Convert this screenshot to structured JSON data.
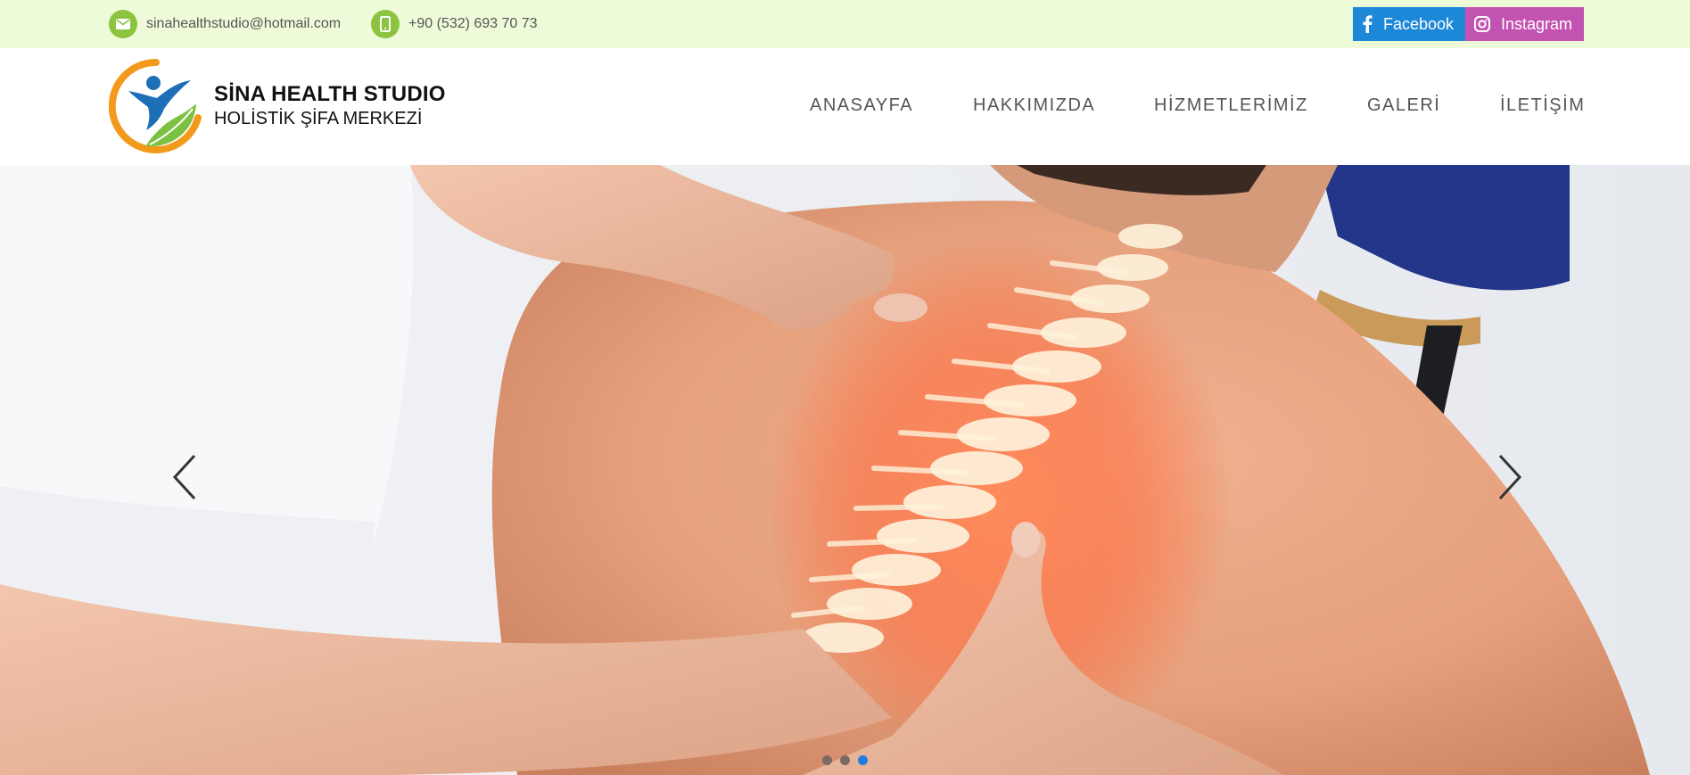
{
  "topbar": {
    "email": "sinahealthstudio@hotmail.com",
    "email_icon": "envelope-icon",
    "phone": "+90 (532) 693 70 73",
    "phone_icon": "mobile-phone-icon",
    "accent_color": "#8cc43f",
    "background": "#eefbd9"
  },
  "social": {
    "facebook": {
      "label": "Facebook",
      "icon": "facebook-icon",
      "color": "#1e88d8"
    },
    "instagram": {
      "label": "Instagram",
      "icon": "instagram-icon",
      "color": "#c353b1"
    }
  },
  "brand": {
    "title": "SİNA HEALTH STUDIO",
    "subtitle": "HOLİSTİK ŞİFA MERKEZİ",
    "logo_icon": "person-leaf-logo"
  },
  "nav": {
    "items": [
      {
        "label": "ANASAYFA"
      },
      {
        "label": "HAKKIMIZDA"
      },
      {
        "label": "HİZMETLERİMİZ"
      },
      {
        "label": "GALERİ"
      },
      {
        "label": "İLETİŞİM"
      }
    ]
  },
  "slider": {
    "image_description_icon": "back-massage-spine-image",
    "prev_icon": "chevron-left-icon",
    "next_icon": "chevron-right-icon",
    "slide_count": 3,
    "active_slide": 3
  }
}
